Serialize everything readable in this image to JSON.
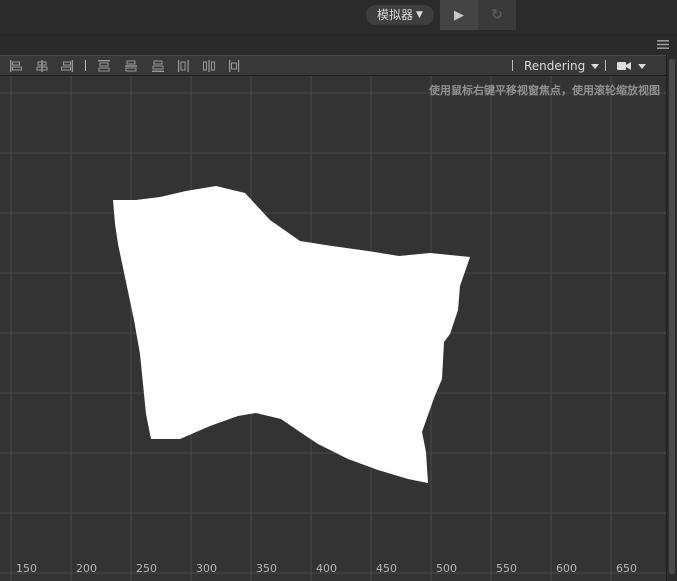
{
  "topbar": {
    "simulator_label": "模拟器",
    "simulator_caret": "▼",
    "play_glyph": "▶",
    "refresh_glyph": "↻"
  },
  "toolbar": {
    "separator_char": "|",
    "rendering_label": "Rendering",
    "icons": [
      "align-left-icon",
      "align-center-h-icon",
      "align-right-icon",
      "align-top-icon",
      "align-middle-v-icon",
      "align-bottom-icon",
      "distribute-h-icon",
      "distribute-center-icon",
      "distribute-v-icon"
    ],
    "camera_icon": "camera-icon"
  },
  "viewport": {
    "hint": "使用鼠标右键平移视窗焦点，使用滚轮缩放视图",
    "x_axis_labels": [
      "150",
      "200",
      "250",
      "300",
      "350",
      "400",
      "450",
      "500",
      "550",
      "600",
      "650"
    ],
    "background_color": "#333333",
    "grid_color": "#4a4a4a",
    "shape_color": "#ffffff"
  }
}
